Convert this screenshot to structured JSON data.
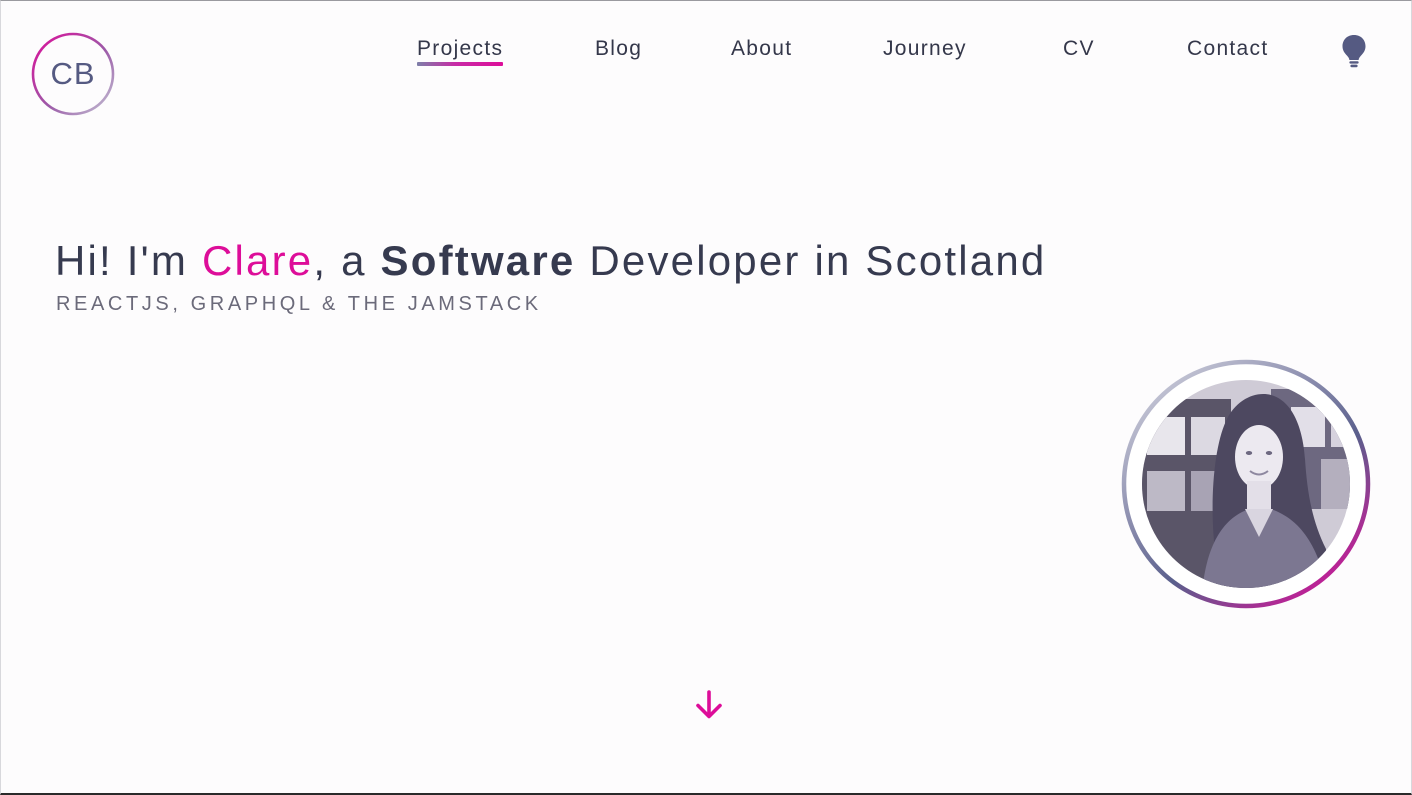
{
  "logo": {
    "initials": "CB",
    "ring_gradient": [
      "#dd0d99",
      "#b7b8cc"
    ]
  },
  "nav": {
    "items": [
      {
        "label": "Projects",
        "active": true
      },
      {
        "label": "Blog",
        "active": false
      },
      {
        "label": "About",
        "active": false
      },
      {
        "label": "Journey",
        "active": false
      },
      {
        "label": "CV",
        "active": false
      },
      {
        "label": "Contact",
        "active": false
      }
    ],
    "theme_toggle_icon": "lightbulb-icon"
  },
  "hero": {
    "greeting": "Hi! I'm ",
    "name": "Clare",
    "middle": ", a ",
    "role_strong": "Software",
    "role_rest": " Developer in Scotland",
    "subtitle": "REACTJS, GRAPHQL & THE JAMSTACK"
  },
  "avatar": {
    "icon": "profile-photo",
    "ring_gradient": [
      "#c9c9d6",
      "#5a5f8c",
      "#dd0d99"
    ]
  },
  "scroll": {
    "icon": "arrow-down-icon"
  },
  "colors": {
    "accent": "#dd0d99",
    "text": "#363a4f",
    "muted": "#6b6a7a",
    "logo_text": "#555a82",
    "background": "#fdfcfd"
  }
}
